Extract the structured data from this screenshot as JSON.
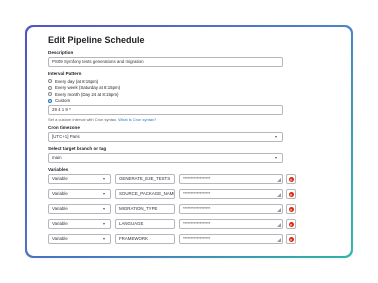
{
  "title": "Edit Pipeline Schedule",
  "description": {
    "label": "Description",
    "value": "PS09 Symfony tests generations and migration"
  },
  "interval": {
    "label": "Interval Pattern",
    "options": [
      "Every day (at 8:15pm)",
      "Every week (Saturday at 8:15pm)",
      "Every month (Day 24 at 8:15pm)",
      "Custom"
    ],
    "selected": "Custom",
    "value": "29 4 1 9 *",
    "help_prefix": "Set a custom interval with Cron syntax.",
    "help_link": "What is Cron syntax?"
  },
  "timezone": {
    "label": "Cron timezone",
    "value": "[UTC+1] Paris"
  },
  "target": {
    "label": "Select target branch or tag",
    "value": "main"
  },
  "variables": {
    "label": "Variables",
    "rows": [
      {
        "type": "Variable",
        "key": "GENERATE_E2E_TESTS",
        "value": "******************"
      },
      {
        "type": "Variable",
        "key": "SOURCE_PACKAGE_NAME",
        "value": "******************"
      },
      {
        "type": "Variable",
        "key": "MIGRATION_TYPE",
        "value": "******************"
      },
      {
        "type": "Variable",
        "key": "LANGUAGE",
        "value": "******************"
      },
      {
        "type": "Variable",
        "key": "FRAMEWORK",
        "value": "******************"
      }
    ]
  },
  "colors": {
    "accent": "#1f75cb",
    "danger": "#dd2b0e"
  },
  "icons": {
    "select": "chevron-down-icon",
    "remove": "remove-icon",
    "resize": "resize-handle-icon"
  }
}
